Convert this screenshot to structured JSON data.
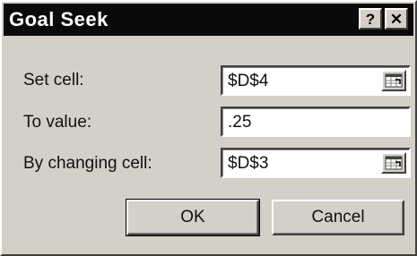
{
  "window": {
    "title": "Goal Seek",
    "help_glyph": "?",
    "close_glyph": "✕"
  },
  "fields": [
    {
      "label": "Set cell:",
      "value": "$D$4",
      "has_collapse_button": true
    },
    {
      "label": "To value:",
      "value": ".25",
      "has_collapse_button": false
    },
    {
      "label": "By changing cell:",
      "value": "$D$3",
      "has_collapse_button": true
    }
  ],
  "buttons": {
    "ok_label": "OK",
    "cancel_label": "Cancel"
  },
  "icons": {
    "help": "help-icon",
    "close": "close-icon",
    "collapse": "collapse-dialog-icon"
  },
  "colors": {
    "face": "#d4d0c8",
    "title_bar": "#0a0a0a",
    "title_text": "#ffffff"
  }
}
